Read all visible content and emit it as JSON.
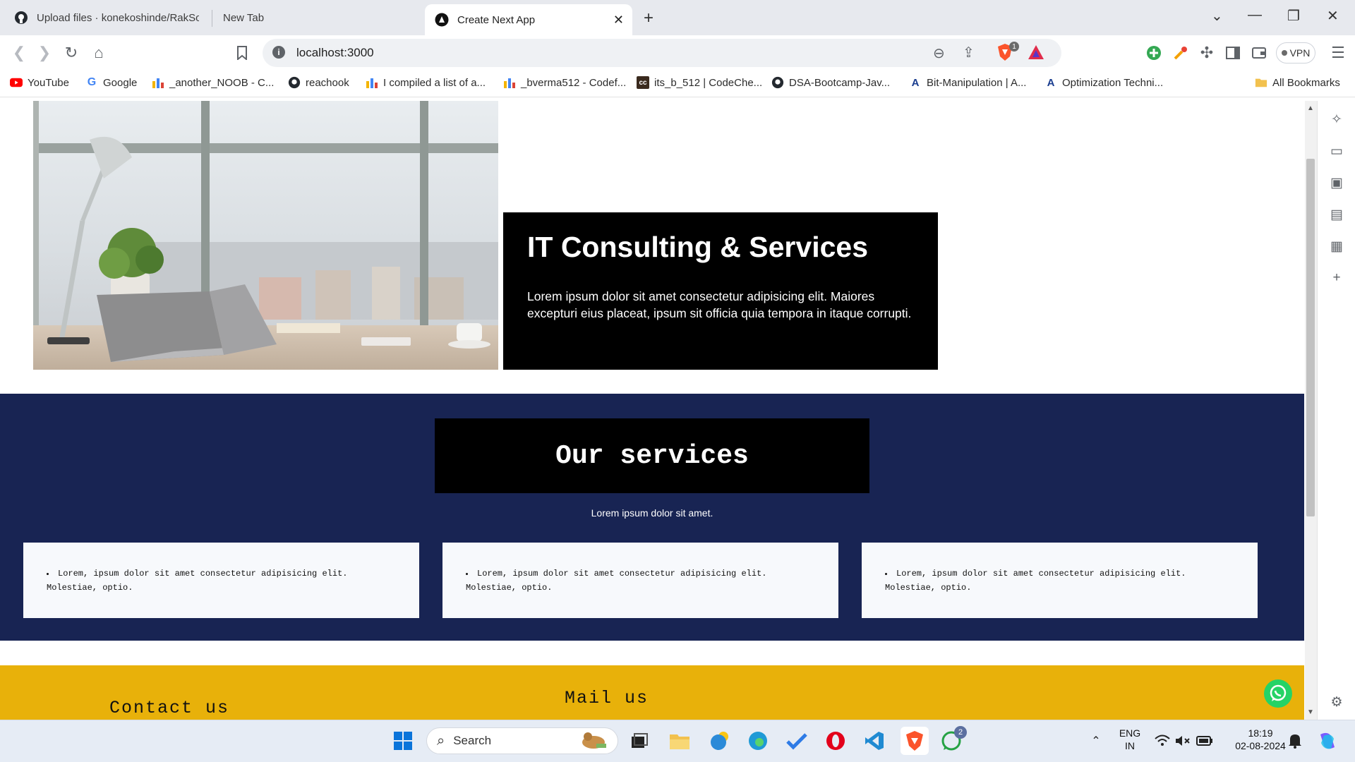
{
  "tabs": [
    {
      "title": "Upload files · konekoshinde/RakSoft",
      "icon": "github-icon"
    },
    {
      "title": "New Tab",
      "icon": "none"
    },
    {
      "title": "Create Next App",
      "icon": "nextjs-icon",
      "active": true
    }
  ],
  "toolbar": {
    "url": "localhost:3000",
    "vpn_label": "VPN",
    "brave_badge": "1"
  },
  "bookmarks": [
    {
      "label": "YouTube",
      "icon": "youtube-icon"
    },
    {
      "label": "Google",
      "icon": "google-icon"
    },
    {
      "label": "_another_NOOB - C...",
      "icon": "chart-bars-icon"
    },
    {
      "label": "reachook",
      "icon": "github-icon"
    },
    {
      "label": "I compiled a list of a...",
      "icon": "chart-bars-icon"
    },
    {
      "label": "_bverma512 - Codef...",
      "icon": "chart-bars-icon"
    },
    {
      "label": "its_b_512 | CodeChe...",
      "icon": "codechef-icon"
    },
    {
      "label": "DSA-Bootcamp-Jav...",
      "icon": "github-icon"
    },
    {
      "label": "Bit-Manipulation | A...",
      "icon": "algo-icon"
    },
    {
      "label": "Optimization Techni...",
      "icon": "algo-icon"
    }
  ],
  "all_bookmarks_label": "All Bookmarks",
  "page": {
    "hero": {
      "title": "IT Consulting & Services",
      "text": "Lorem ipsum dolor sit amet consectetur adipisicing elit. Maiores excepturi eius placeat, ipsum sit officia quia tempora in itaque corrupti."
    },
    "services": {
      "title": "Our services",
      "subtitle": "Lorem ipsum dolor sit amet.",
      "cards": [
        {
          "text": "Lorem, ipsum dolor sit amet consectetur adipisicing elit. Molestiae, optio."
        },
        {
          "text": "Lorem, ipsum dolor sit amet consectetur adipisicing elit. Molestiae, optio."
        },
        {
          "text": "Lorem, ipsum dolor sit amet consectetur adipisicing elit. Molestiae, optio."
        }
      ]
    },
    "contact": {
      "contact_title": "Contact us",
      "mail_title": "Mail us"
    }
  },
  "colors": {
    "services_bg": "#182453",
    "contact_bg": "#e8b10a",
    "card_bg": "#f7f9fc",
    "accent_black": "#000000"
  },
  "taskbar": {
    "search_label": "Search",
    "lang_top": "ENG",
    "lang_bottom": "IN",
    "time": "18:19",
    "date": "02-08-2024",
    "whatsapp_badge": "2"
  }
}
